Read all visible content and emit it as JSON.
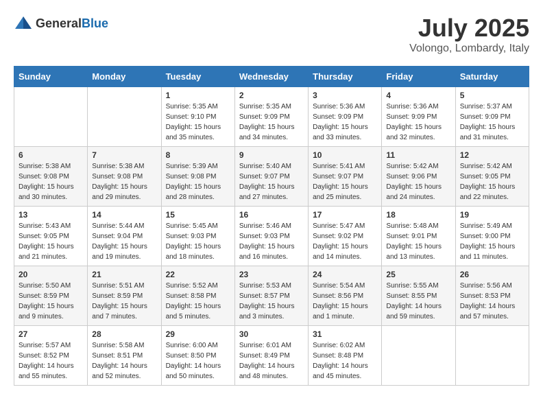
{
  "header": {
    "logo_general": "General",
    "logo_blue": "Blue",
    "month_title": "July 2025",
    "location": "Volongo, Lombardy, Italy"
  },
  "days_of_week": [
    "Sunday",
    "Monday",
    "Tuesday",
    "Wednesday",
    "Thursday",
    "Friday",
    "Saturday"
  ],
  "weeks": [
    [
      {
        "day": "",
        "info": ""
      },
      {
        "day": "",
        "info": ""
      },
      {
        "day": "1",
        "info": "Sunrise: 5:35 AM\nSunset: 9:10 PM\nDaylight: 15 hours and 35 minutes."
      },
      {
        "day": "2",
        "info": "Sunrise: 5:35 AM\nSunset: 9:09 PM\nDaylight: 15 hours and 34 minutes."
      },
      {
        "day": "3",
        "info": "Sunrise: 5:36 AM\nSunset: 9:09 PM\nDaylight: 15 hours and 33 minutes."
      },
      {
        "day": "4",
        "info": "Sunrise: 5:36 AM\nSunset: 9:09 PM\nDaylight: 15 hours and 32 minutes."
      },
      {
        "day": "5",
        "info": "Sunrise: 5:37 AM\nSunset: 9:09 PM\nDaylight: 15 hours and 31 minutes."
      }
    ],
    [
      {
        "day": "6",
        "info": "Sunrise: 5:38 AM\nSunset: 9:08 PM\nDaylight: 15 hours and 30 minutes."
      },
      {
        "day": "7",
        "info": "Sunrise: 5:38 AM\nSunset: 9:08 PM\nDaylight: 15 hours and 29 minutes."
      },
      {
        "day": "8",
        "info": "Sunrise: 5:39 AM\nSunset: 9:08 PM\nDaylight: 15 hours and 28 minutes."
      },
      {
        "day": "9",
        "info": "Sunrise: 5:40 AM\nSunset: 9:07 PM\nDaylight: 15 hours and 27 minutes."
      },
      {
        "day": "10",
        "info": "Sunrise: 5:41 AM\nSunset: 9:07 PM\nDaylight: 15 hours and 25 minutes."
      },
      {
        "day": "11",
        "info": "Sunrise: 5:42 AM\nSunset: 9:06 PM\nDaylight: 15 hours and 24 minutes."
      },
      {
        "day": "12",
        "info": "Sunrise: 5:42 AM\nSunset: 9:05 PM\nDaylight: 15 hours and 22 minutes."
      }
    ],
    [
      {
        "day": "13",
        "info": "Sunrise: 5:43 AM\nSunset: 9:05 PM\nDaylight: 15 hours and 21 minutes."
      },
      {
        "day": "14",
        "info": "Sunrise: 5:44 AM\nSunset: 9:04 PM\nDaylight: 15 hours and 19 minutes."
      },
      {
        "day": "15",
        "info": "Sunrise: 5:45 AM\nSunset: 9:03 PM\nDaylight: 15 hours and 18 minutes."
      },
      {
        "day": "16",
        "info": "Sunrise: 5:46 AM\nSunset: 9:03 PM\nDaylight: 15 hours and 16 minutes."
      },
      {
        "day": "17",
        "info": "Sunrise: 5:47 AM\nSunset: 9:02 PM\nDaylight: 15 hours and 14 minutes."
      },
      {
        "day": "18",
        "info": "Sunrise: 5:48 AM\nSunset: 9:01 PM\nDaylight: 15 hours and 13 minutes."
      },
      {
        "day": "19",
        "info": "Sunrise: 5:49 AM\nSunset: 9:00 PM\nDaylight: 15 hours and 11 minutes."
      }
    ],
    [
      {
        "day": "20",
        "info": "Sunrise: 5:50 AM\nSunset: 8:59 PM\nDaylight: 15 hours and 9 minutes."
      },
      {
        "day": "21",
        "info": "Sunrise: 5:51 AM\nSunset: 8:59 PM\nDaylight: 15 hours and 7 minutes."
      },
      {
        "day": "22",
        "info": "Sunrise: 5:52 AM\nSunset: 8:58 PM\nDaylight: 15 hours and 5 minutes."
      },
      {
        "day": "23",
        "info": "Sunrise: 5:53 AM\nSunset: 8:57 PM\nDaylight: 15 hours and 3 minutes."
      },
      {
        "day": "24",
        "info": "Sunrise: 5:54 AM\nSunset: 8:56 PM\nDaylight: 15 hours and 1 minute."
      },
      {
        "day": "25",
        "info": "Sunrise: 5:55 AM\nSunset: 8:55 PM\nDaylight: 14 hours and 59 minutes."
      },
      {
        "day": "26",
        "info": "Sunrise: 5:56 AM\nSunset: 8:53 PM\nDaylight: 14 hours and 57 minutes."
      }
    ],
    [
      {
        "day": "27",
        "info": "Sunrise: 5:57 AM\nSunset: 8:52 PM\nDaylight: 14 hours and 55 minutes."
      },
      {
        "day": "28",
        "info": "Sunrise: 5:58 AM\nSunset: 8:51 PM\nDaylight: 14 hours and 52 minutes."
      },
      {
        "day": "29",
        "info": "Sunrise: 6:00 AM\nSunset: 8:50 PM\nDaylight: 14 hours and 50 minutes."
      },
      {
        "day": "30",
        "info": "Sunrise: 6:01 AM\nSunset: 8:49 PM\nDaylight: 14 hours and 48 minutes."
      },
      {
        "day": "31",
        "info": "Sunrise: 6:02 AM\nSunset: 8:48 PM\nDaylight: 14 hours and 45 minutes."
      },
      {
        "day": "",
        "info": ""
      },
      {
        "day": "",
        "info": ""
      }
    ]
  ]
}
